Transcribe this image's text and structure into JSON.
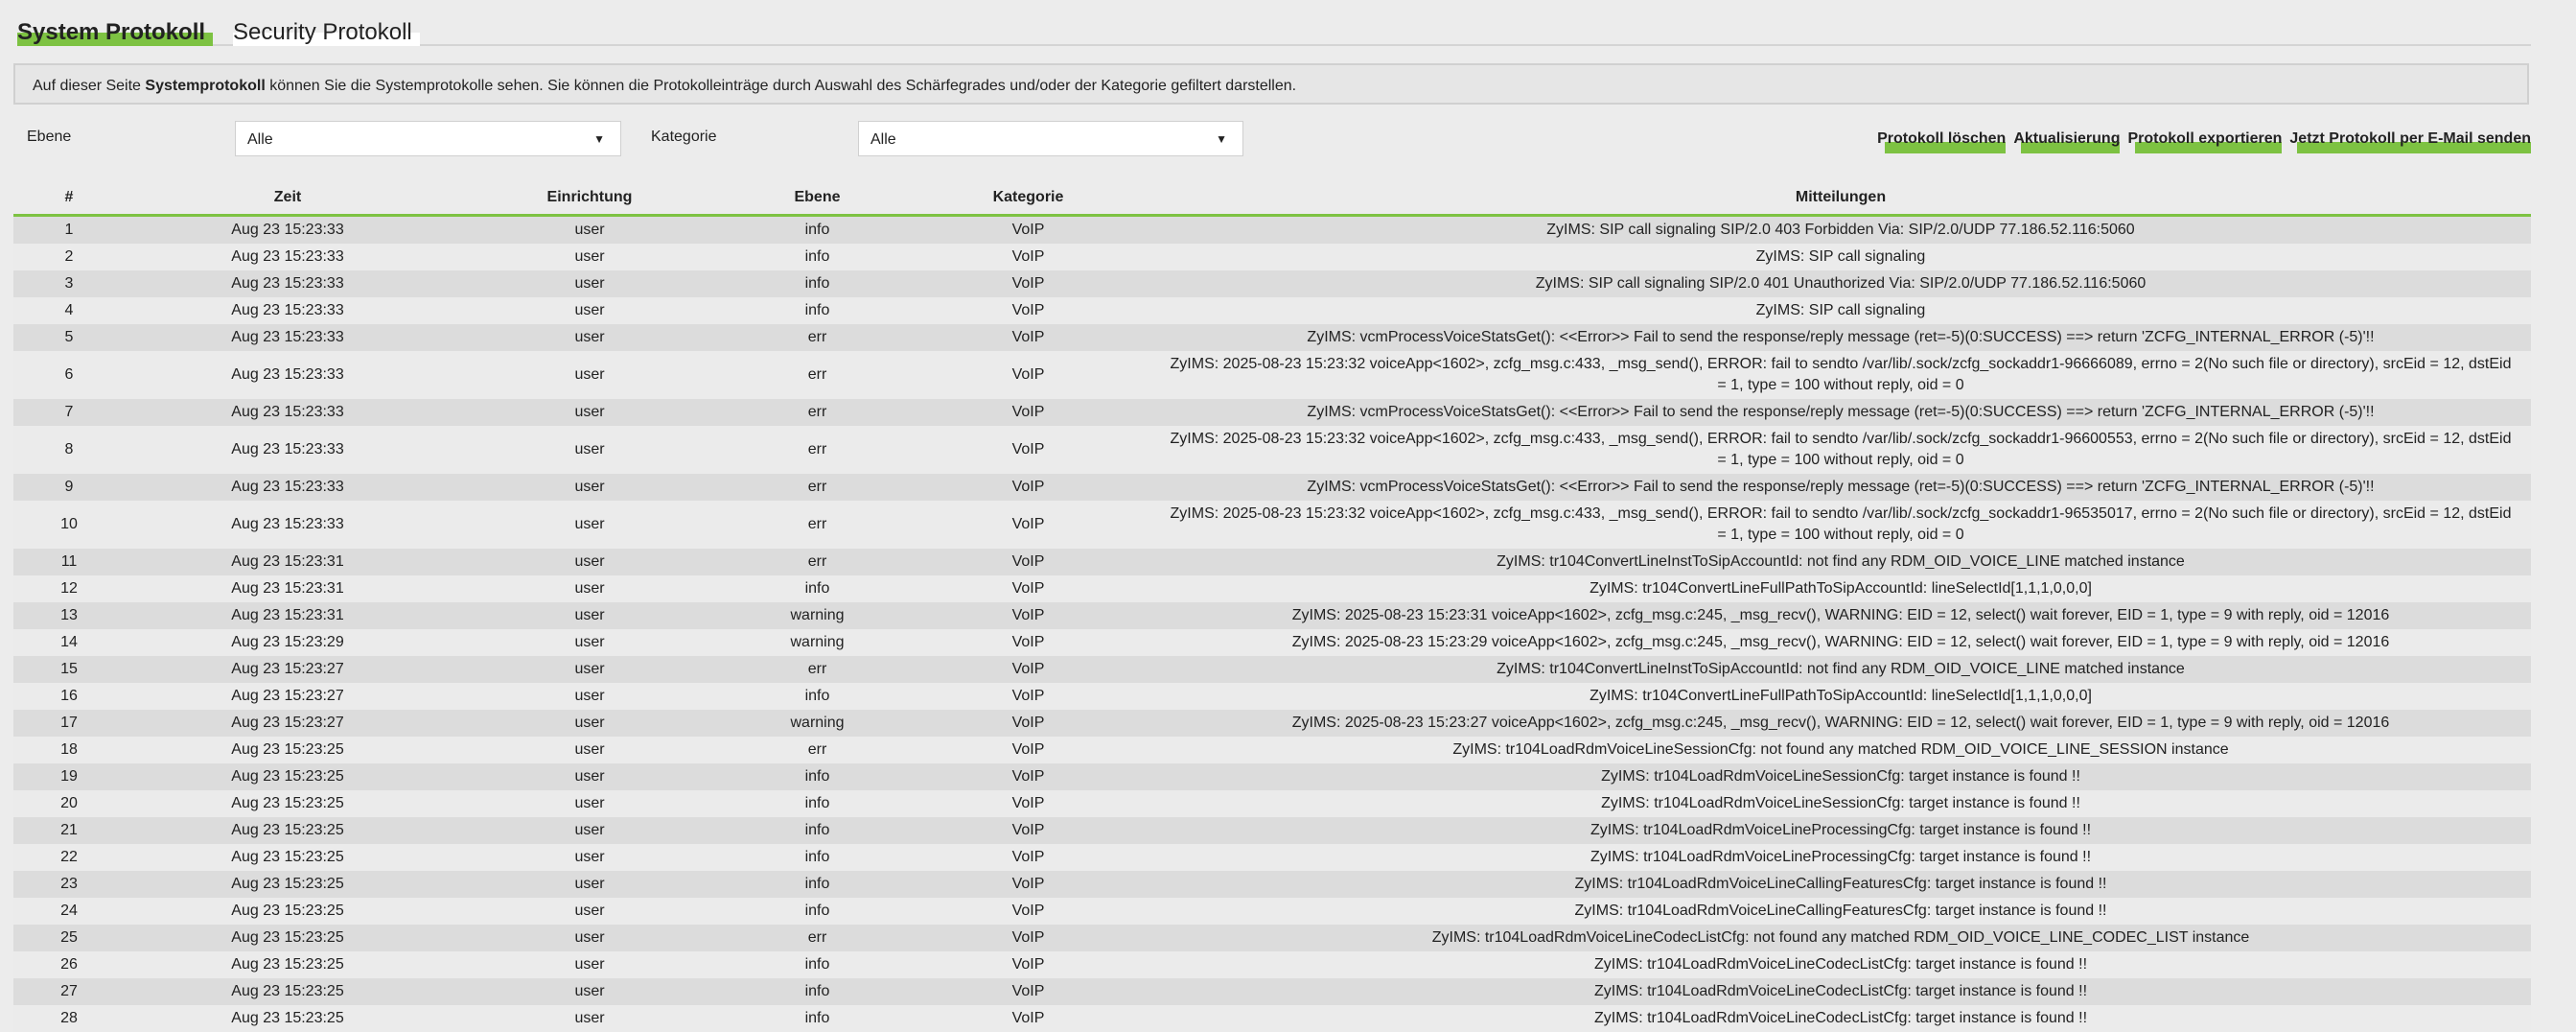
{
  "tabs": [
    {
      "label": "System Protokoll",
      "active": true
    },
    {
      "label": "Security Protokoll",
      "active": false
    }
  ],
  "description": {
    "pre": "Auf dieser Seite ",
    "bold": "Systemprotokoll",
    "post": " können Sie die Systemprotokolle sehen. Sie können die Protokolleinträge durch Auswahl des Schärfegrades und/oder der Kategorie gefiltert darstellen."
  },
  "filters": {
    "level_label": "Ebene",
    "level_value": "Alle",
    "category_label": "Kategorie",
    "category_value": "Alle"
  },
  "actions": [
    "Protokoll löschen",
    "Aktualisierung",
    "Protokoll exportieren",
    "Jetzt Protokoll per E-Mail senden"
  ],
  "accent_color": "#7dc242",
  "table": {
    "headers": [
      "#",
      "Zeit",
      "Einrichtung",
      "Ebene",
      "Kategorie",
      "Mitteilungen"
    ],
    "rows": [
      [
        "1",
        "Aug 23 15:23:33",
        "user",
        "info",
        "VoIP",
        "ZyIMS: SIP call signaling SIP/2.0 403 Forbidden Via: SIP/2.0/UDP 77.186.52.116:5060"
      ],
      [
        "2",
        "Aug 23 15:23:33",
        "user",
        "info",
        "VoIP",
        "ZyIMS: SIP call signaling"
      ],
      [
        "3",
        "Aug 23 15:23:33",
        "user",
        "info",
        "VoIP",
        "ZyIMS: SIP call signaling SIP/2.0 401 Unauthorized Via: SIP/2.0/UDP 77.186.52.116:5060"
      ],
      [
        "4",
        "Aug 23 15:23:33",
        "user",
        "info",
        "VoIP",
        "ZyIMS: SIP call signaling"
      ],
      [
        "5",
        "Aug 23 15:23:33",
        "user",
        "err",
        "VoIP",
        "ZyIMS: vcmProcessVoiceStatsGet(): <<Error>> Fail to send the response/reply message (ret=-5)(0:SUCCESS) ==> return 'ZCFG_INTERNAL_ERROR (-5)'!!"
      ],
      [
        "6",
        "Aug 23 15:23:33",
        "user",
        "err",
        "VoIP",
        "ZyIMS: 2025-08-23 15:23:32 voiceApp<1602>, zcfg_msg.c:433, _msg_send(), ERROR: fail to sendto /var/lib/.sock/zcfg_sockaddr1-96666089, errno = 2(No such file or directory), srcEid = 12, dstEid = 1, type = 100 without reply, oid = 0"
      ],
      [
        "7",
        "Aug 23 15:23:33",
        "user",
        "err",
        "VoIP",
        "ZyIMS: vcmProcessVoiceStatsGet(): <<Error>> Fail to send the response/reply message (ret=-5)(0:SUCCESS) ==> return 'ZCFG_INTERNAL_ERROR (-5)'!!"
      ],
      [
        "8",
        "Aug 23 15:23:33",
        "user",
        "err",
        "VoIP",
        "ZyIMS: 2025-08-23 15:23:32 voiceApp<1602>, zcfg_msg.c:433, _msg_send(), ERROR: fail to sendto /var/lib/.sock/zcfg_sockaddr1-96600553, errno = 2(No such file or directory), srcEid = 12, dstEid = 1, type = 100 without reply, oid = 0"
      ],
      [
        "9",
        "Aug 23 15:23:33",
        "user",
        "err",
        "VoIP",
        "ZyIMS: vcmProcessVoiceStatsGet(): <<Error>> Fail to send the response/reply message (ret=-5)(0:SUCCESS) ==> return 'ZCFG_INTERNAL_ERROR (-5)'!!"
      ],
      [
        "10",
        "Aug 23 15:23:33",
        "user",
        "err",
        "VoIP",
        "ZyIMS: 2025-08-23 15:23:32 voiceApp<1602>, zcfg_msg.c:433, _msg_send(), ERROR: fail to sendto /var/lib/.sock/zcfg_sockaddr1-96535017, errno = 2(No such file or directory), srcEid = 12, dstEid = 1, type = 100 without reply, oid = 0"
      ],
      [
        "11",
        "Aug 23 15:23:31",
        "user",
        "err",
        "VoIP",
        "ZyIMS: tr104ConvertLineInstToSipAccountId: not find any RDM_OID_VOICE_LINE matched instance"
      ],
      [
        "12",
        "Aug 23 15:23:31",
        "user",
        "info",
        "VoIP",
        "ZyIMS: tr104ConvertLineFullPathToSipAccountId: lineSelectId[1,1,1,0,0,0]"
      ],
      [
        "13",
        "Aug 23 15:23:31",
        "user",
        "warning",
        "VoIP",
        "ZyIMS: 2025-08-23 15:23:31 voiceApp<1602>, zcfg_msg.c:245, _msg_recv(), WARNING: EID = 12, select() wait forever, EID = 1, type = 9 with reply, oid = 12016"
      ],
      [
        "14",
        "Aug 23 15:23:29",
        "user",
        "warning",
        "VoIP",
        "ZyIMS: 2025-08-23 15:23:29 voiceApp<1602>, zcfg_msg.c:245, _msg_recv(), WARNING: EID = 12, select() wait forever, EID = 1, type = 9 with reply, oid = 12016"
      ],
      [
        "15",
        "Aug 23 15:23:27",
        "user",
        "err",
        "VoIP",
        "ZyIMS: tr104ConvertLineInstToSipAccountId: not find any RDM_OID_VOICE_LINE matched instance"
      ],
      [
        "16",
        "Aug 23 15:23:27",
        "user",
        "info",
        "VoIP",
        "ZyIMS: tr104ConvertLineFullPathToSipAccountId: lineSelectId[1,1,1,0,0,0]"
      ],
      [
        "17",
        "Aug 23 15:23:27",
        "user",
        "warning",
        "VoIP",
        "ZyIMS: 2025-08-23 15:23:27 voiceApp<1602>, zcfg_msg.c:245, _msg_recv(), WARNING: EID = 12, select() wait forever, EID = 1, type = 9 with reply, oid = 12016"
      ],
      [
        "18",
        "Aug 23 15:23:25",
        "user",
        "err",
        "VoIP",
        "ZyIMS: tr104LoadRdmVoiceLineSessionCfg: not found any matched RDM_OID_VOICE_LINE_SESSION instance"
      ],
      [
        "19",
        "Aug 23 15:23:25",
        "user",
        "info",
        "VoIP",
        "ZyIMS: tr104LoadRdmVoiceLineSessionCfg: target instance is found !!"
      ],
      [
        "20",
        "Aug 23 15:23:25",
        "user",
        "info",
        "VoIP",
        "ZyIMS: tr104LoadRdmVoiceLineSessionCfg: target instance is found !!"
      ],
      [
        "21",
        "Aug 23 15:23:25",
        "user",
        "info",
        "VoIP",
        "ZyIMS: tr104LoadRdmVoiceLineProcessingCfg: target instance is found !!"
      ],
      [
        "22",
        "Aug 23 15:23:25",
        "user",
        "info",
        "VoIP",
        "ZyIMS: tr104LoadRdmVoiceLineProcessingCfg: target instance is found !!"
      ],
      [
        "23",
        "Aug 23 15:23:25",
        "user",
        "info",
        "VoIP",
        "ZyIMS: tr104LoadRdmVoiceLineCallingFeaturesCfg: target instance is found !!"
      ],
      [
        "24",
        "Aug 23 15:23:25",
        "user",
        "info",
        "VoIP",
        "ZyIMS: tr104LoadRdmVoiceLineCallingFeaturesCfg: target instance is found !!"
      ],
      [
        "25",
        "Aug 23 15:23:25",
        "user",
        "err",
        "VoIP",
        "ZyIMS: tr104LoadRdmVoiceLineCodecListCfg: not found any matched RDM_OID_VOICE_LINE_CODEC_LIST instance"
      ],
      [
        "26",
        "Aug 23 15:23:25",
        "user",
        "info",
        "VoIP",
        "ZyIMS: tr104LoadRdmVoiceLineCodecListCfg: target instance is found !!"
      ],
      [
        "27",
        "Aug 23 15:23:25",
        "user",
        "info",
        "VoIP",
        "ZyIMS: tr104LoadRdmVoiceLineCodecListCfg: target instance is found !!"
      ],
      [
        "28",
        "Aug 23 15:23:25",
        "user",
        "info",
        "VoIP",
        "ZyIMS: tr104LoadRdmVoiceLineCodecListCfg: target instance is found !!"
      ]
    ]
  }
}
